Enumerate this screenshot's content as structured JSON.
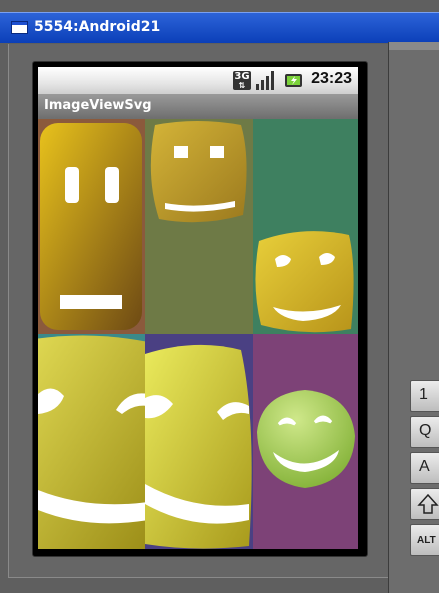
{
  "window": {
    "title": "5554:Android21"
  },
  "status_bar": {
    "time": "23:23",
    "network_label": "3G",
    "icons": [
      "network-3g-icon",
      "signal-strength-icon",
      "battery-charging-icon"
    ]
  },
  "app": {
    "title": "ImageViewSvg"
  },
  "keyboard": {
    "keys": [
      "1",
      "Q",
      "A",
      "ALT"
    ],
    "icons": [
      "shift-arrow-icon"
    ]
  },
  "colors": {
    "title_bar": "#1e4fd0",
    "cell_brown": "#8b5a3c",
    "cell_olive": "#6e7a46",
    "cell_green": "#3e8060",
    "cell_teal": "#3b8a8a",
    "cell_indigo": "#4a4083",
    "cell_purple": "#7d4277",
    "face_yellow": "#c79c1c",
    "face_lime": "#d6d84a",
    "face_green": "#9cc84a"
  },
  "image_cells": [
    "smiley-face-tall-rectangle",
    "smiley-face-small-top",
    "smiley-face-small-bottom",
    "smiley-face-large-cropped-left",
    "smiley-face-large-cropped-right",
    "smiley-face-round-green"
  ]
}
